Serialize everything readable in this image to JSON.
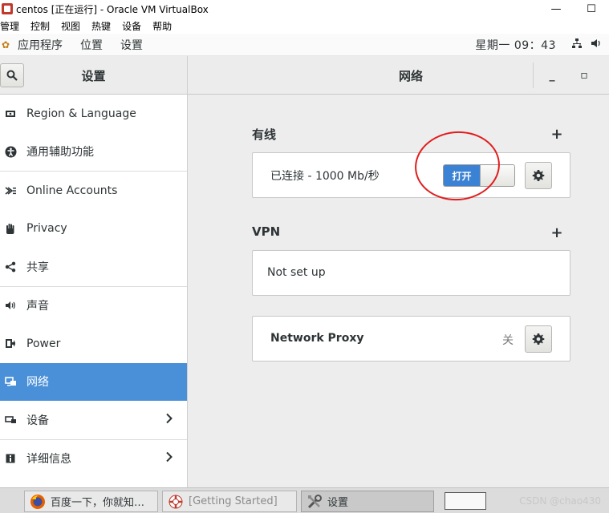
{
  "host_window": {
    "title": "centos [正在运行] - Oracle VM VirtualBox",
    "minimize": "—",
    "maximize": "☐",
    "menu": [
      "管理",
      "控制",
      "视图",
      "热键",
      "设备",
      "帮助"
    ]
  },
  "guest_panel": {
    "menus": [
      "应用程序",
      "位置",
      "设置"
    ],
    "clock": "星期一 09：43",
    "icons": [
      "network-icon",
      "volume-icon"
    ]
  },
  "settings": {
    "sidebar_title": "设置",
    "panel_title": "网络",
    "window_minimize": "_",
    "window_restore": "▫",
    "sidebar": [
      {
        "label": "Region & Language",
        "icon": "region-icon"
      },
      {
        "label": "通用辅助功能",
        "icon": "accessibility-icon"
      },
      {
        "label": "Online Accounts",
        "icon": "online-accounts-icon"
      },
      {
        "label": "Privacy",
        "icon": "privacy-hand-icon"
      },
      {
        "label": "共享",
        "icon": "share-icon"
      },
      {
        "label": "声音",
        "icon": "sound-icon"
      },
      {
        "label": "Power",
        "icon": "power-icon"
      },
      {
        "label": "网络",
        "icon": "network-icon",
        "selected": true
      },
      {
        "label": "设备",
        "icon": "devices-icon",
        "chevron": true
      },
      {
        "label": "详细信息",
        "icon": "info-icon",
        "chevron": true
      }
    ],
    "wired": {
      "title": "有线",
      "add": "+",
      "status": "已连接 - 1000 Mb/秒",
      "toggle_on_label": "打开",
      "toggle_state": true
    },
    "vpn": {
      "title": "VPN",
      "add": "+",
      "empty": "Not set up"
    },
    "proxy": {
      "label": "Network Proxy",
      "state": "关"
    }
  },
  "taskbar": {
    "items": [
      {
        "label": "百度一下，你就知…",
        "icon": "firefox-icon"
      },
      {
        "label": "[Getting Started]",
        "icon": "help-lifebuoy-icon"
      },
      {
        "label": "设置",
        "icon": "settings-tools-icon",
        "active": true
      }
    ],
    "watermark": "CSDN @chao430"
  },
  "colors": {
    "accent": "#4a90d9",
    "toggle_on": "#3b82d4",
    "annotation": "#e11d1d"
  }
}
